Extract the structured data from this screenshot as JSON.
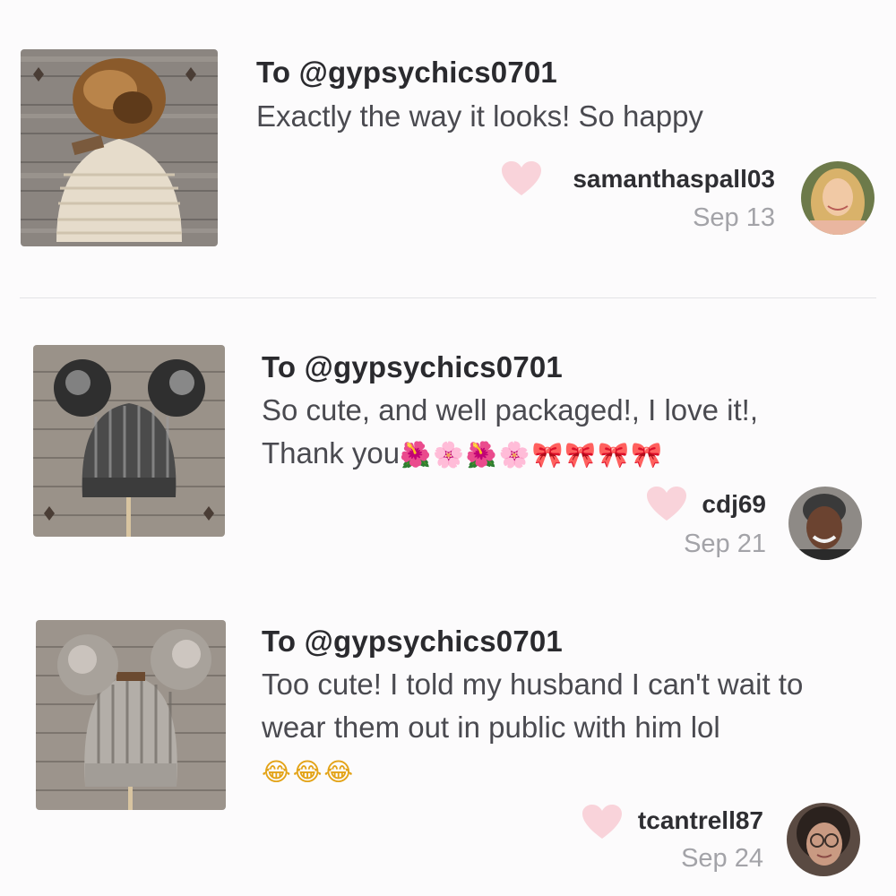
{
  "reviews": [
    {
      "to": "To @gypsychics0701",
      "text": "Exactly the way it looks! So happy",
      "emoji": "",
      "username": "samanthaspall03",
      "date": "Sep 13",
      "product_image": "beige-knit-beanie-with-fur-pompom",
      "avatar": "avatar-blonde-woman"
    },
    {
      "to": "To @gypsychics0701",
      "text": "So cute, and well packaged!, I love it!, Thank you",
      "emoji": "🌺🌸🌺🌸🎀🎀🎀🎀",
      "username": "cdj69",
      "date": "Sep 21",
      "product_image": "gray-black-knit-hat-double-pompoms",
      "avatar": "avatar-smiling-woman"
    },
    {
      "to": "To @gypsychics0701",
      "text": "Too cute! I told my husband I can't wait to wear them out in public with him lol",
      "emoji": "😂😂😂",
      "username": "tcantrell87",
      "date": "Sep 24",
      "product_image": "gray-white-knit-hat-double-pompoms",
      "avatar": "avatar-woman-glasses"
    }
  ],
  "colors": {
    "heart": "#f9d3da",
    "background": "#fcfbfc",
    "divider": "#e3e3e6",
    "date": "#a3a3a8"
  }
}
